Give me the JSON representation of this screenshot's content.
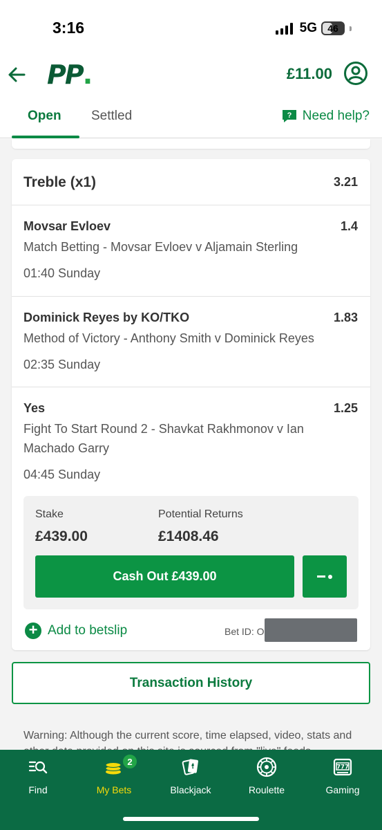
{
  "status_bar": {
    "time": "3:16",
    "network": "5G",
    "battery": "46"
  },
  "header": {
    "logo_text": "PP",
    "balance": "£11.00"
  },
  "tabs": [
    {
      "label": "Open",
      "active": true
    },
    {
      "label": "Settled",
      "active": false
    }
  ],
  "help": {
    "label": "Need help?"
  },
  "bet": {
    "type": "Treble (x1)",
    "odds": "3.21",
    "legs": [
      {
        "selection": "Movsar Evloev",
        "odds": "1.4",
        "market": "Match Betting - Movsar Evloev v Aljamain Sterling",
        "time": "01:40 Sunday"
      },
      {
        "selection": "Dominick Reyes by KO/TKO",
        "odds": "1.83",
        "market": "Method of Victory - Anthony Smith v Dominick Reyes",
        "time": "02:35 Sunday"
      },
      {
        "selection": "Yes",
        "odds": "1.25",
        "market": "Fight To Start Round 2 - Shavkat Rakhmonov v Ian Machado Garry",
        "time": "04:45 Sunday"
      }
    ],
    "stake_label": "Stake",
    "stake_value": "£439.00",
    "returns_label": "Potential Returns",
    "returns_value": "£1408.46",
    "cashout_label": "Cash Out £439.00",
    "add_to_betslip": "Add to betslip",
    "bet_id_label": "Bet ID: O"
  },
  "transaction_history": "Transaction History",
  "warning": "Warning: Although the current score, time elapsed, video, stats and other data provided on this site is sourced from \"live\" feeds",
  "bottom_nav": {
    "items": [
      {
        "label": "Find",
        "icon": "search-list-icon"
      },
      {
        "label": "My Bets",
        "icon": "coins-icon",
        "active": true,
        "badge": "2"
      },
      {
        "label": "Blackjack",
        "icon": "cards-icon"
      },
      {
        "label": "Roulette",
        "icon": "roulette-icon"
      },
      {
        "label": "Gaming",
        "icon": "slot-machine-icon"
      }
    ]
  },
  "colors": {
    "brand_green": "#0b8a45",
    "nav_bg": "#0b6b44",
    "active_nav": "#f5d90a",
    "button_green": "#0c9444"
  }
}
